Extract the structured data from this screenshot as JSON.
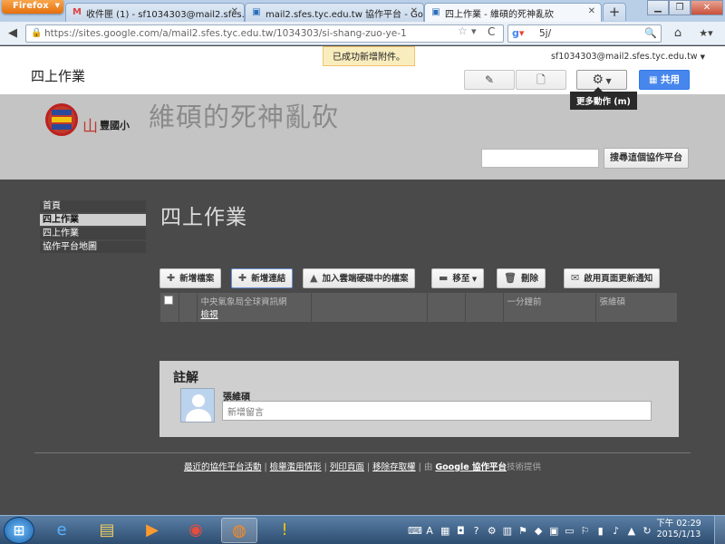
{
  "browser": {
    "app_button": "Firefox",
    "tabs": [
      {
        "label": "收件匣 (1) - sf1034303@mail2.sfes.t...",
        "icon": "gmail-icon",
        "active": false
      },
      {
        "label": "mail2.sfes.tyc.edu.tw 協作平台 - Go...",
        "icon": "sites-icon",
        "active": false
      },
      {
        "label": "四上作業 - 維碩的死神亂砍",
        "icon": "sites-icon",
        "active": true
      }
    ],
    "new_tab": "+",
    "url": "https://sites.google.com/a/mail2.sfes.tyc.edu.tw/1034303/si-shang-zuo-ye-1",
    "search_value": "5j/"
  },
  "site": {
    "toast": "已成功新增附件。",
    "user_email": "sf1034303@mail2.sfes.tyc.edu.tw",
    "page_name": "四上作業",
    "share_label": "共用",
    "more_actions_tooltip": "更多動作 (m)",
    "site_name": "維碩的死神亂砍",
    "school_mountain": "山",
    "school_name": "豐國小",
    "search_button": "搜尋這個協作平台"
  },
  "sidebar": {
    "items": [
      {
        "label": "首頁",
        "active": false
      },
      {
        "label": "四上作業",
        "active": true
      },
      {
        "label": "四上作業",
        "active": false
      },
      {
        "label": "協作平台地圖",
        "active": false
      }
    ]
  },
  "page": {
    "title": "四上作業",
    "buttons": {
      "add_file": "新增檔案",
      "add_link": "新增連結",
      "add_drive": "加入雲端硬碟中的檔案",
      "move_to": "移至",
      "delete": "刪除",
      "notify": "啟用頁面更新通知"
    },
    "file_row": {
      "name": "中央氣象局全球資訊網",
      "view": "檢視",
      "time": "一分鐘前",
      "author": "張維碩"
    }
  },
  "comments": {
    "title": "註解",
    "author": "張維碩",
    "placeholder": "新增留言"
  },
  "footer": {
    "recent": "最近的協作平台活動",
    "abuse": "檢舉濫用情形",
    "print": "列印頁面",
    "remove_access": "移除存取權",
    "powered_by_prefix": "由",
    "powered_by_link": "Google 協作平台",
    "powered_by_suffix": "技術提供"
  },
  "taskbar": {
    "time": "下午 02:29",
    "date": "2015/1/13"
  }
}
